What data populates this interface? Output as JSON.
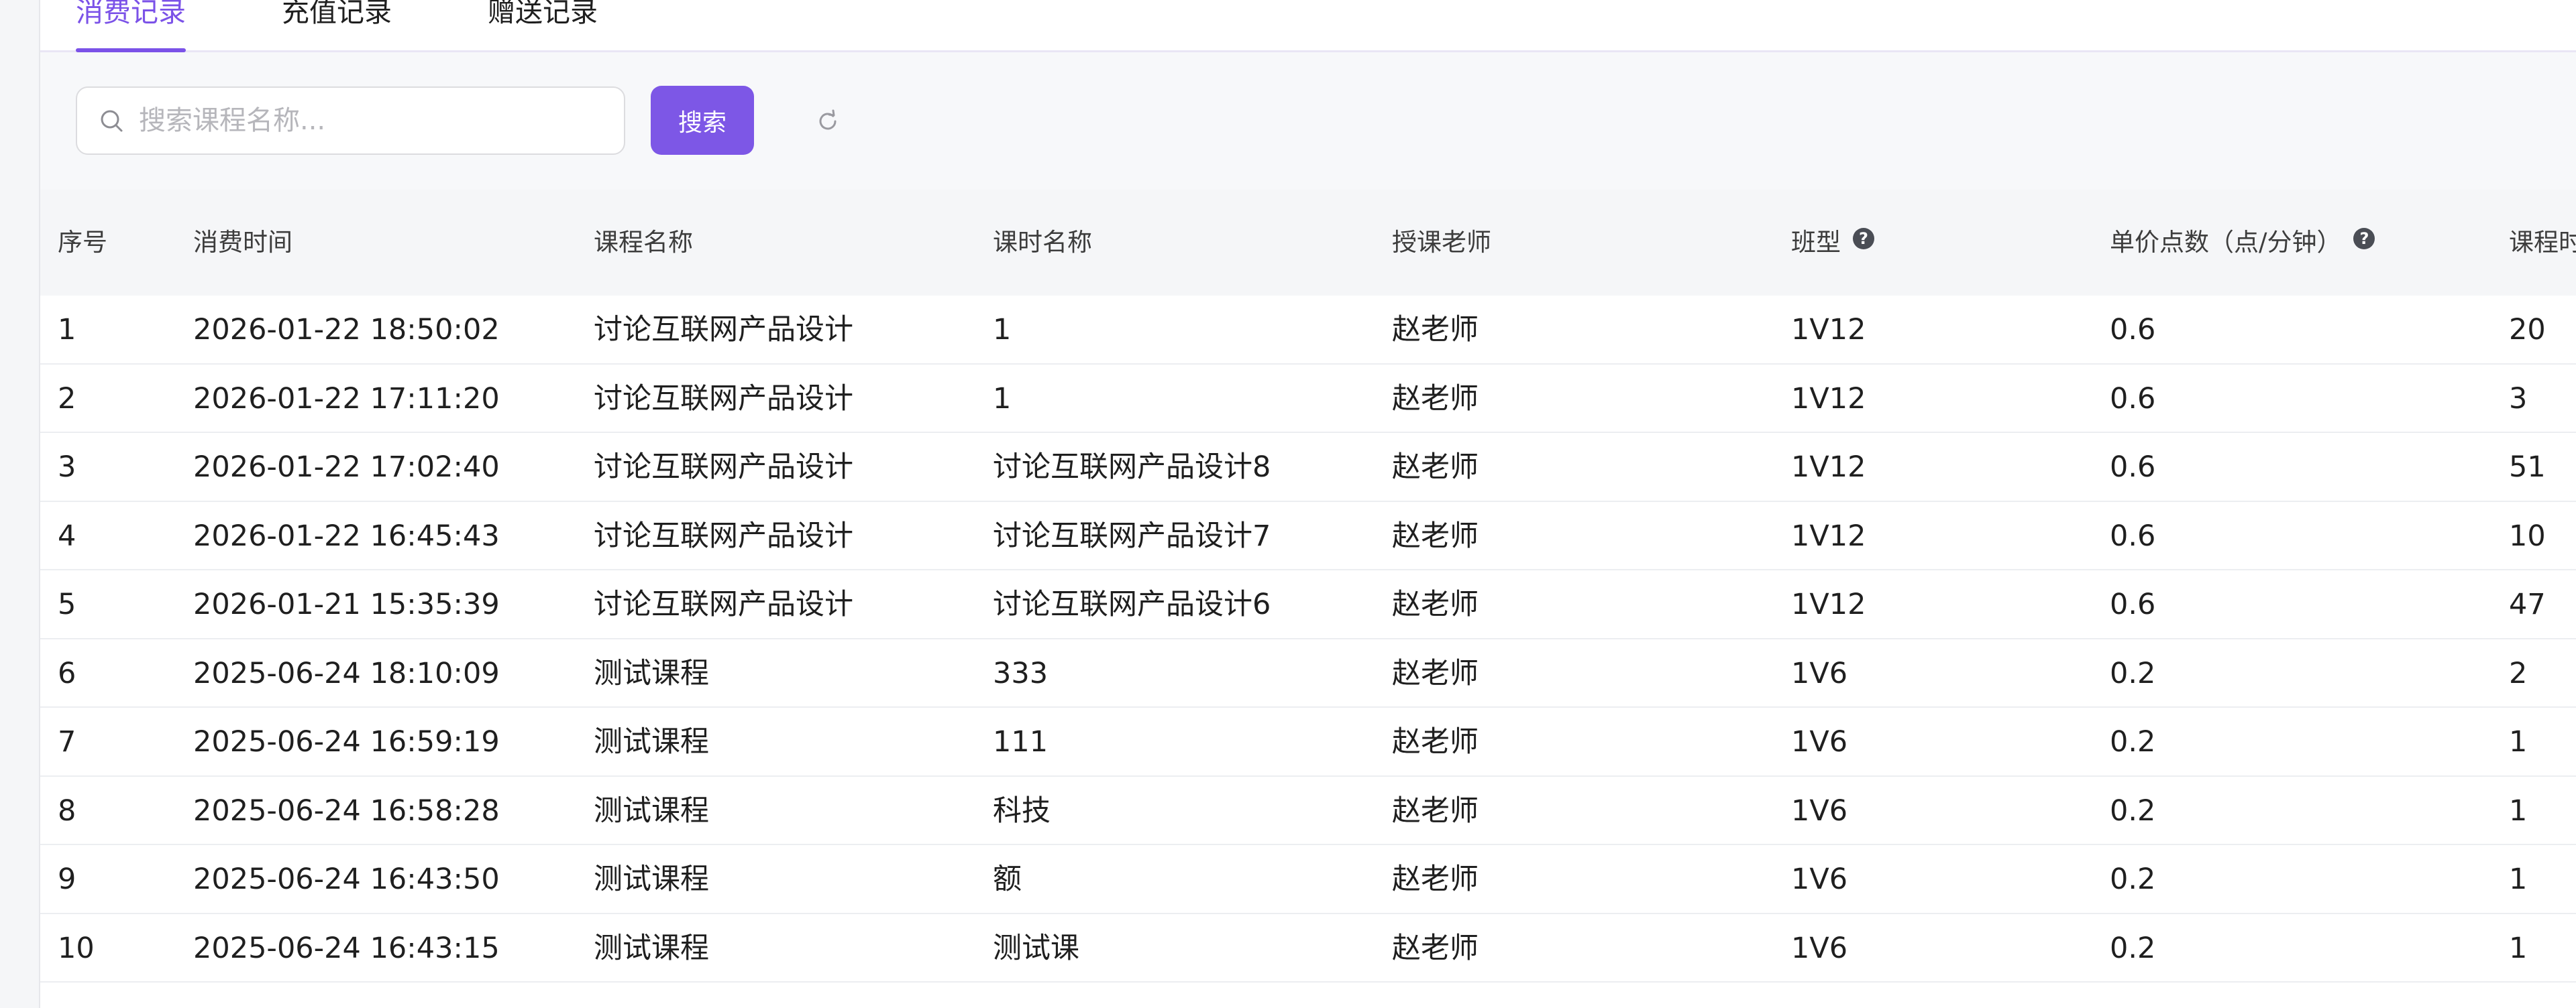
{
  "tabs": [
    "消费记录",
    "充值记录",
    "赠送记录"
  ],
  "search": {
    "placeholder": "搜索课程名称...",
    "button_label": "搜索"
  },
  "table": {
    "columns": [
      "序号",
      "消费时间",
      "课程名称",
      "课时名称",
      "授课老师",
      "班型",
      "单价点数（点/分钟）",
      "课程时"
    ],
    "help_icon_columns": [
      5,
      6
    ],
    "rows": [
      [
        "1",
        "2026-01-22 18:50:02",
        "讨论互联网产品设计",
        "1",
        "赵老师",
        "1V12",
        "0.6",
        "20"
      ],
      [
        "2",
        "2026-01-22 17:11:20",
        "讨论互联网产品设计",
        "1",
        "赵老师",
        "1V12",
        "0.6",
        "3"
      ],
      [
        "3",
        "2026-01-22 17:02:40",
        "讨论互联网产品设计",
        "讨论互联网产品设计8",
        "赵老师",
        "1V12",
        "0.6",
        "51"
      ],
      [
        "4",
        "2026-01-22 16:45:43",
        "讨论互联网产品设计",
        "讨论互联网产品设计7",
        "赵老师",
        "1V12",
        "0.6",
        "10"
      ],
      [
        "5",
        "2026-01-21 15:35:39",
        "讨论互联网产品设计",
        "讨论互联网产品设计6",
        "赵老师",
        "1V12",
        "0.6",
        "47"
      ],
      [
        "6",
        "2025-06-24 18:10:09",
        "测试课程",
        "333",
        "赵老师",
        "1V6",
        "0.2",
        "2"
      ],
      [
        "7",
        "2025-06-24 16:59:19",
        "测试课程",
        "111",
        "赵老师",
        "1V6",
        "0.2",
        "1"
      ],
      [
        "8",
        "2025-06-24 16:58:28",
        "测试课程",
        "科技",
        "赵老师",
        "1V6",
        "0.2",
        "1"
      ],
      [
        "9",
        "2025-06-24 16:43:50",
        "测试课程",
        "额",
        "赵老师",
        "1V6",
        "0.2",
        "1"
      ],
      [
        "10",
        "2025-06-24 16:43:15",
        "测试课程",
        "测试课",
        "赵老师",
        "1V6",
        "0.2",
        "1"
      ]
    ]
  },
  "colors": {
    "accent": "#7d57e6",
    "tab_active": "#7b52e8"
  },
  "icons": {
    "search": "search-icon",
    "refresh": "refresh-icon",
    "help": "help-icon"
  }
}
